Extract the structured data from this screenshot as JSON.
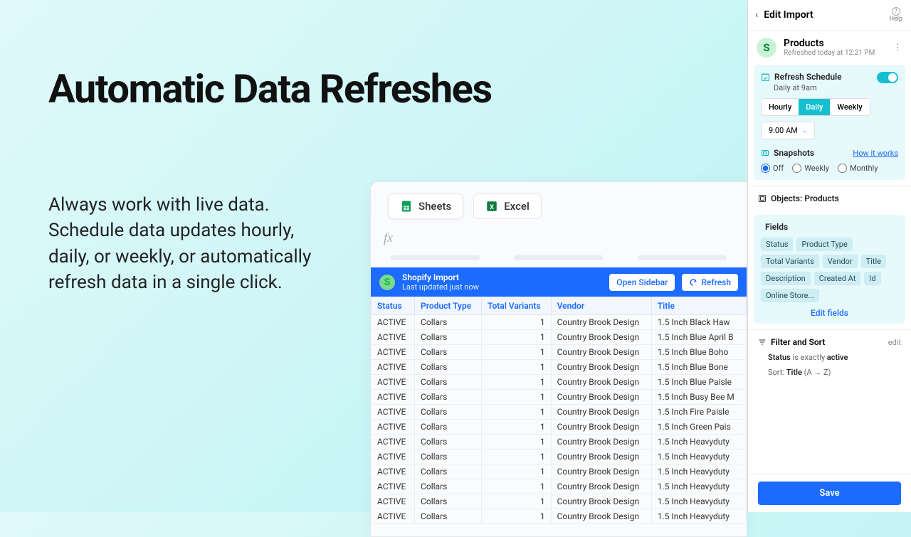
{
  "hero": {
    "title": "Automatic Data Refreshes",
    "description": "Always work with live data. Schedule data updates hourly, daily, or weekly, or automatically refresh data in a single click."
  },
  "sheet": {
    "tabs": {
      "sheets": "Sheets",
      "excel": "Excel"
    },
    "fx": "fx",
    "import_bar": {
      "title": "Shopify Import",
      "subtitle": "Last updated just now",
      "open_sidebar": "Open Sidebar",
      "refresh": "Refresh"
    },
    "columns": [
      "Status",
      "Product Type",
      "Total Variants",
      "Vendor",
      "Title"
    ],
    "rows": [
      [
        "ACTIVE",
        "Collars",
        "1",
        "Country Brook Design",
        "1.5 Inch Black Haw"
      ],
      [
        "ACTIVE",
        "Collars",
        "1",
        "Country Brook Design",
        "1.5 Inch Blue April B"
      ],
      [
        "ACTIVE",
        "Collars",
        "1",
        "Country Brook Design",
        "1.5 Inch Blue Boho"
      ],
      [
        "ACTIVE",
        "Collars",
        "1",
        "Country Brook Design",
        "1.5 Inch Blue Bone"
      ],
      [
        "ACTIVE",
        "Collars",
        "1",
        "Country Brook Design",
        "1.5 Inch Blue Paisle"
      ],
      [
        "ACTIVE",
        "Collars",
        "1",
        "Country Brook Design",
        "1.5 Inch Busy Bee M"
      ],
      [
        "ACTIVE",
        "Collars",
        "1",
        "Country Brook Design",
        "1.5 Inch Fire Paisle"
      ],
      [
        "ACTIVE",
        "Collars",
        "1",
        "Country Brook Design",
        "1.5 Inch Green Pais"
      ],
      [
        "ACTIVE",
        "Collars",
        "1",
        "Country Brook Design",
        "1.5 Inch Heavyduty"
      ],
      [
        "ACTIVE",
        "Collars",
        "1",
        "Country Brook Design",
        "1.5 Inch Heavyduty"
      ],
      [
        "ACTIVE",
        "Collars",
        "1",
        "Country Brook Design",
        "1.5 Inch Heavyduty"
      ],
      [
        "ACTIVE",
        "Collars",
        "1",
        "Country Brook Design",
        "1.5 Inch Heavyduty"
      ],
      [
        "ACTIVE",
        "Collars",
        "1",
        "Country Brook Design",
        "1.5 Inch Heavyduty"
      ],
      [
        "ACTIVE",
        "Collars",
        "1",
        "Country Brook Design",
        "1.5 Inch Heavyduty"
      ]
    ]
  },
  "panel": {
    "header": {
      "title": "Edit Import",
      "help": "Help"
    },
    "source": {
      "name": "Products",
      "subtitle": "Refreshed today at 12:21 PM"
    },
    "schedule": {
      "title": "Refresh Schedule",
      "subtitle": "Daily at 9am",
      "options": [
        "Hourly",
        "Daily",
        "Weekly"
      ],
      "selected": "Daily",
      "time": "9:00 AM"
    },
    "snapshots": {
      "title": "Snapshots",
      "link": "How it works",
      "options": [
        "Off",
        "Weekly",
        "Monthly"
      ],
      "selected": "Off"
    },
    "objects": {
      "title": "Objects: Products"
    },
    "fields": {
      "title": "Fields",
      "chips": [
        "Status",
        "Product Type",
        "Total Variants",
        "Vendor",
        "Title",
        "Description",
        "Created At",
        "Id",
        "Online Store..."
      ],
      "edit": "Edit fields"
    },
    "filter": {
      "title": "Filter and Sort",
      "edit": "edit",
      "status_label": "Status",
      "status_mid": " is exactly ",
      "status_val": "active",
      "sort_label": "Sort: ",
      "sort_field": "Title",
      "sort_dir": " (A → Z)"
    },
    "save": "Save"
  }
}
